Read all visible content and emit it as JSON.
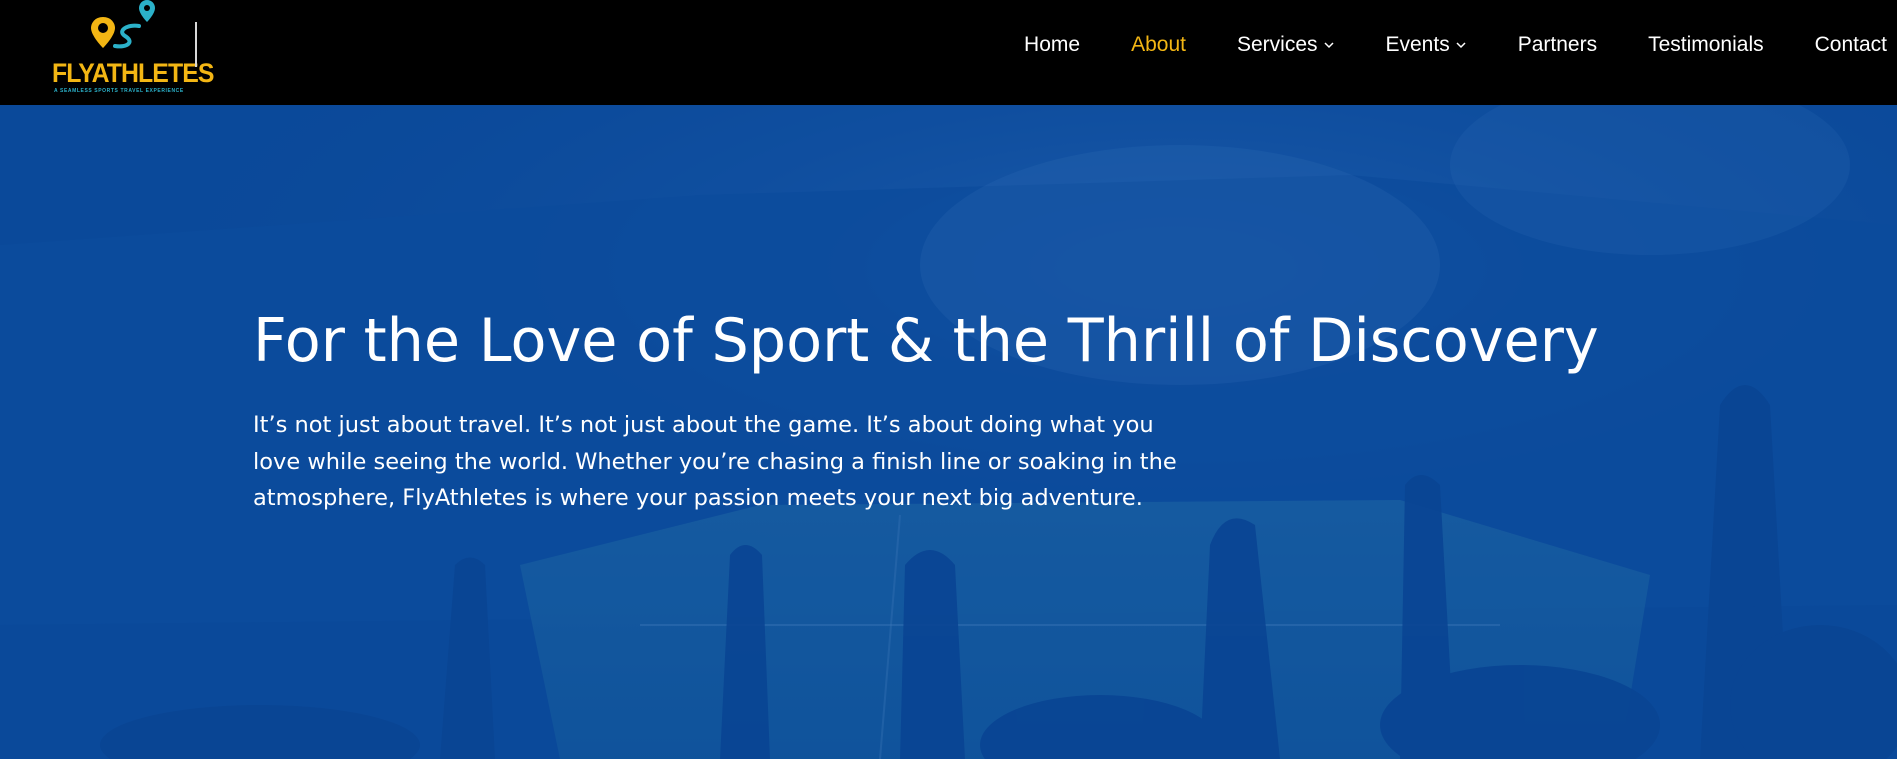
{
  "brand": {
    "name": "FLYATHLETES",
    "tagline": "A SEAMLESS SPORTS TRAVEL EXPERIENCE",
    "colors": {
      "primary": "#f3b614",
      "secondary": "#2bb1c9"
    }
  },
  "nav": {
    "items": [
      {
        "label": "Home",
        "active": false,
        "dropdown": false
      },
      {
        "label": "About",
        "active": true,
        "dropdown": false
      },
      {
        "label": "Services",
        "active": false,
        "dropdown": true
      },
      {
        "label": "Events",
        "active": false,
        "dropdown": true
      },
      {
        "label": "Partners",
        "active": false,
        "dropdown": false
      },
      {
        "label": "Testimonials",
        "active": false,
        "dropdown": false
      },
      {
        "label": "Contact",
        "active": false,
        "dropdown": false
      }
    ],
    "active_color": "#f3b614",
    "text_color": "#ffffff"
  },
  "hero": {
    "title": "For the Love of Sport & the Thrill of Discovery",
    "body": "It’s not just about travel. It’s not just about the game. It’s about doing what you love while seeing the world. Whether you’re chasing a finish line or soaking in the atmosphere, FlyAthletes is where your passion meets your next big adventure.",
    "overlay_color": "#0a4a98"
  }
}
